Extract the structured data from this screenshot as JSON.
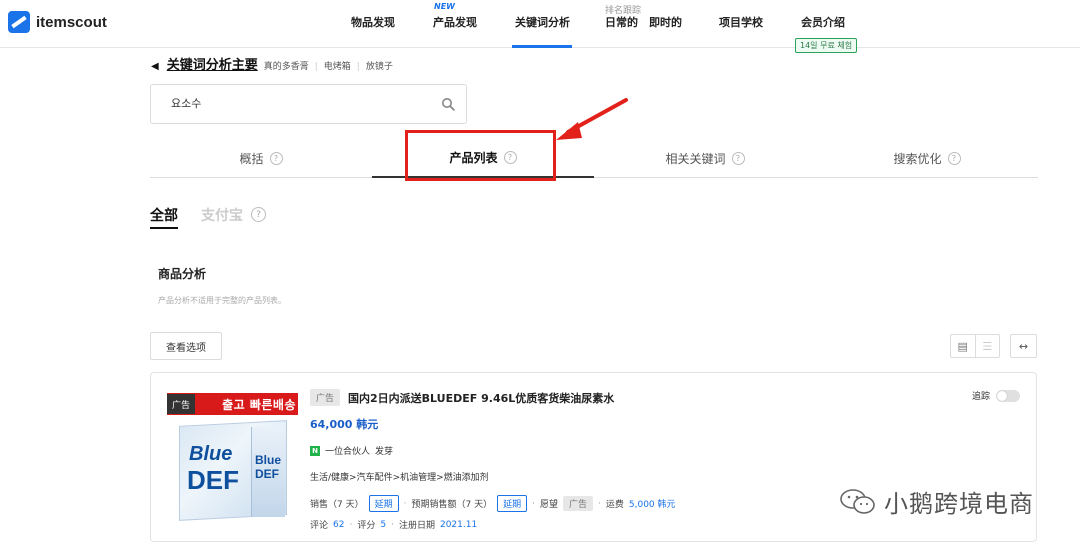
{
  "header": {
    "logo": "itemscout",
    "nav": [
      {
        "label": "物品发现"
      },
      {
        "label": "产品发现",
        "badge": "NEW"
      },
      {
        "label": "关键词分析",
        "active": true
      },
      {
        "label": "日常的",
        "sup": "排名跟踪"
      },
      {
        "label": "即时的"
      },
      {
        "label": "项目学校"
      },
      {
        "label": "会员介绍"
      }
    ],
    "trial_badge": "14일 무료 체험"
  },
  "breadcrumb": {
    "main": "关键词分析主要",
    "tags": [
      "真的多香膏",
      "电烤箱",
      "放镜子"
    ]
  },
  "search": {
    "value": "요소수"
  },
  "tabs": [
    {
      "label": "概括"
    },
    {
      "label": "产品列表",
      "active": true
    },
    {
      "label": "相关关键词"
    },
    {
      "label": "搜索优化"
    }
  ],
  "subtabs": {
    "all": "全部",
    "alipay": "支付宝"
  },
  "section": {
    "title": "商品分析",
    "note": "产品分析不适用于完整的产品列表。"
  },
  "options_button": "查看选项",
  "product": {
    "image_banner": "출고 빠른배송",
    "image_ad": "广告",
    "ad_badge": "广告",
    "title": "国内2日内派送BLUEDEF 9.46L优质客货柴油尿素水",
    "price": "64,000 韩元",
    "seller": "一位合伙人",
    "seller_tag": "发芽",
    "category": "生活/健康>汽车配件>机油管理>燃油添加剂",
    "sales_label": "销售（7 天）",
    "sales_value": "延期",
    "expected_sales_label": "预期销售额（7 天）",
    "expected_sales_value": "延期",
    "wish_label": "愿望",
    "wish_value": "广告",
    "shipping_label": "运费",
    "shipping_value": "5,000 韩元",
    "reviews_label": "评论",
    "reviews_value": "62",
    "rating_label": "评分",
    "rating_value": "5",
    "reg_date_label": "注册日期",
    "reg_date_value": "2021.11",
    "follow_label": "追踪",
    "follow_on": false
  },
  "watermark": "小鹅跨境电商",
  "colors": {
    "accent": "#1a73e8",
    "highlight": "#e3211b",
    "trial_green": "#2ba25a"
  }
}
